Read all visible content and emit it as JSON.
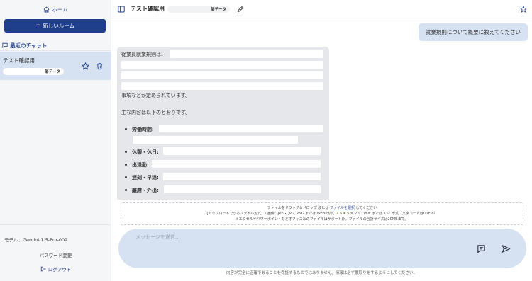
{
  "sidebar": {
    "home_label": "ホーム",
    "new_room_label": "新しいルーム",
    "recent_label": "最近のチャット",
    "chats": [
      {
        "title": "テスト確認用",
        "badge": "部データ"
      }
    ],
    "model_label": "モデル：Gemini-1.5-Pro-002",
    "change_password_label": "パスワード変更",
    "logout_label": "ログアウト"
  },
  "header": {
    "title": "テスト確認用",
    "badge": "部データ"
  },
  "chat": {
    "user_message": "就業規則について概要に教えてください",
    "ai_intro": "従業員就業規則は、",
    "ai_line2": "事項などが定められています。",
    "ai_line3": "主な内容は以下のとおりです。",
    "bullets": [
      "労働時間:",
      "休憩・休日:",
      "出退勤:",
      "遅刻・早退:",
      "離席・外出:"
    ]
  },
  "dropzone": {
    "line1_prefix": "ファイルをドラッグ＆ドロップ または ",
    "line1_link": "ファイルを選択",
    "line1_suffix": " してください",
    "line2": "[アップロードできるファイル形式] ・画像：JPEG, JPG, PNG または WEBP形式 ・ドキュメント：PDF または TXT 形式（文字コードはUTF-8）",
    "line3": "※エクセルやパワーポイントなどオフィス系のファイルはサポート外。ファイルの合計サイズは20MBまで。"
  },
  "input": {
    "placeholder": "メッセージを送信..."
  },
  "disclaimer": "内容が完全に正確であることを保証するものではありません。情報は必ず裏取りをするようにしてください。",
  "colors": {
    "primary": "#1f3f8c",
    "sidebar_bg": "#f5f6f7",
    "selected_bg": "#d6e1f1",
    "ai_bubble_bg": "#e5e7ea"
  }
}
